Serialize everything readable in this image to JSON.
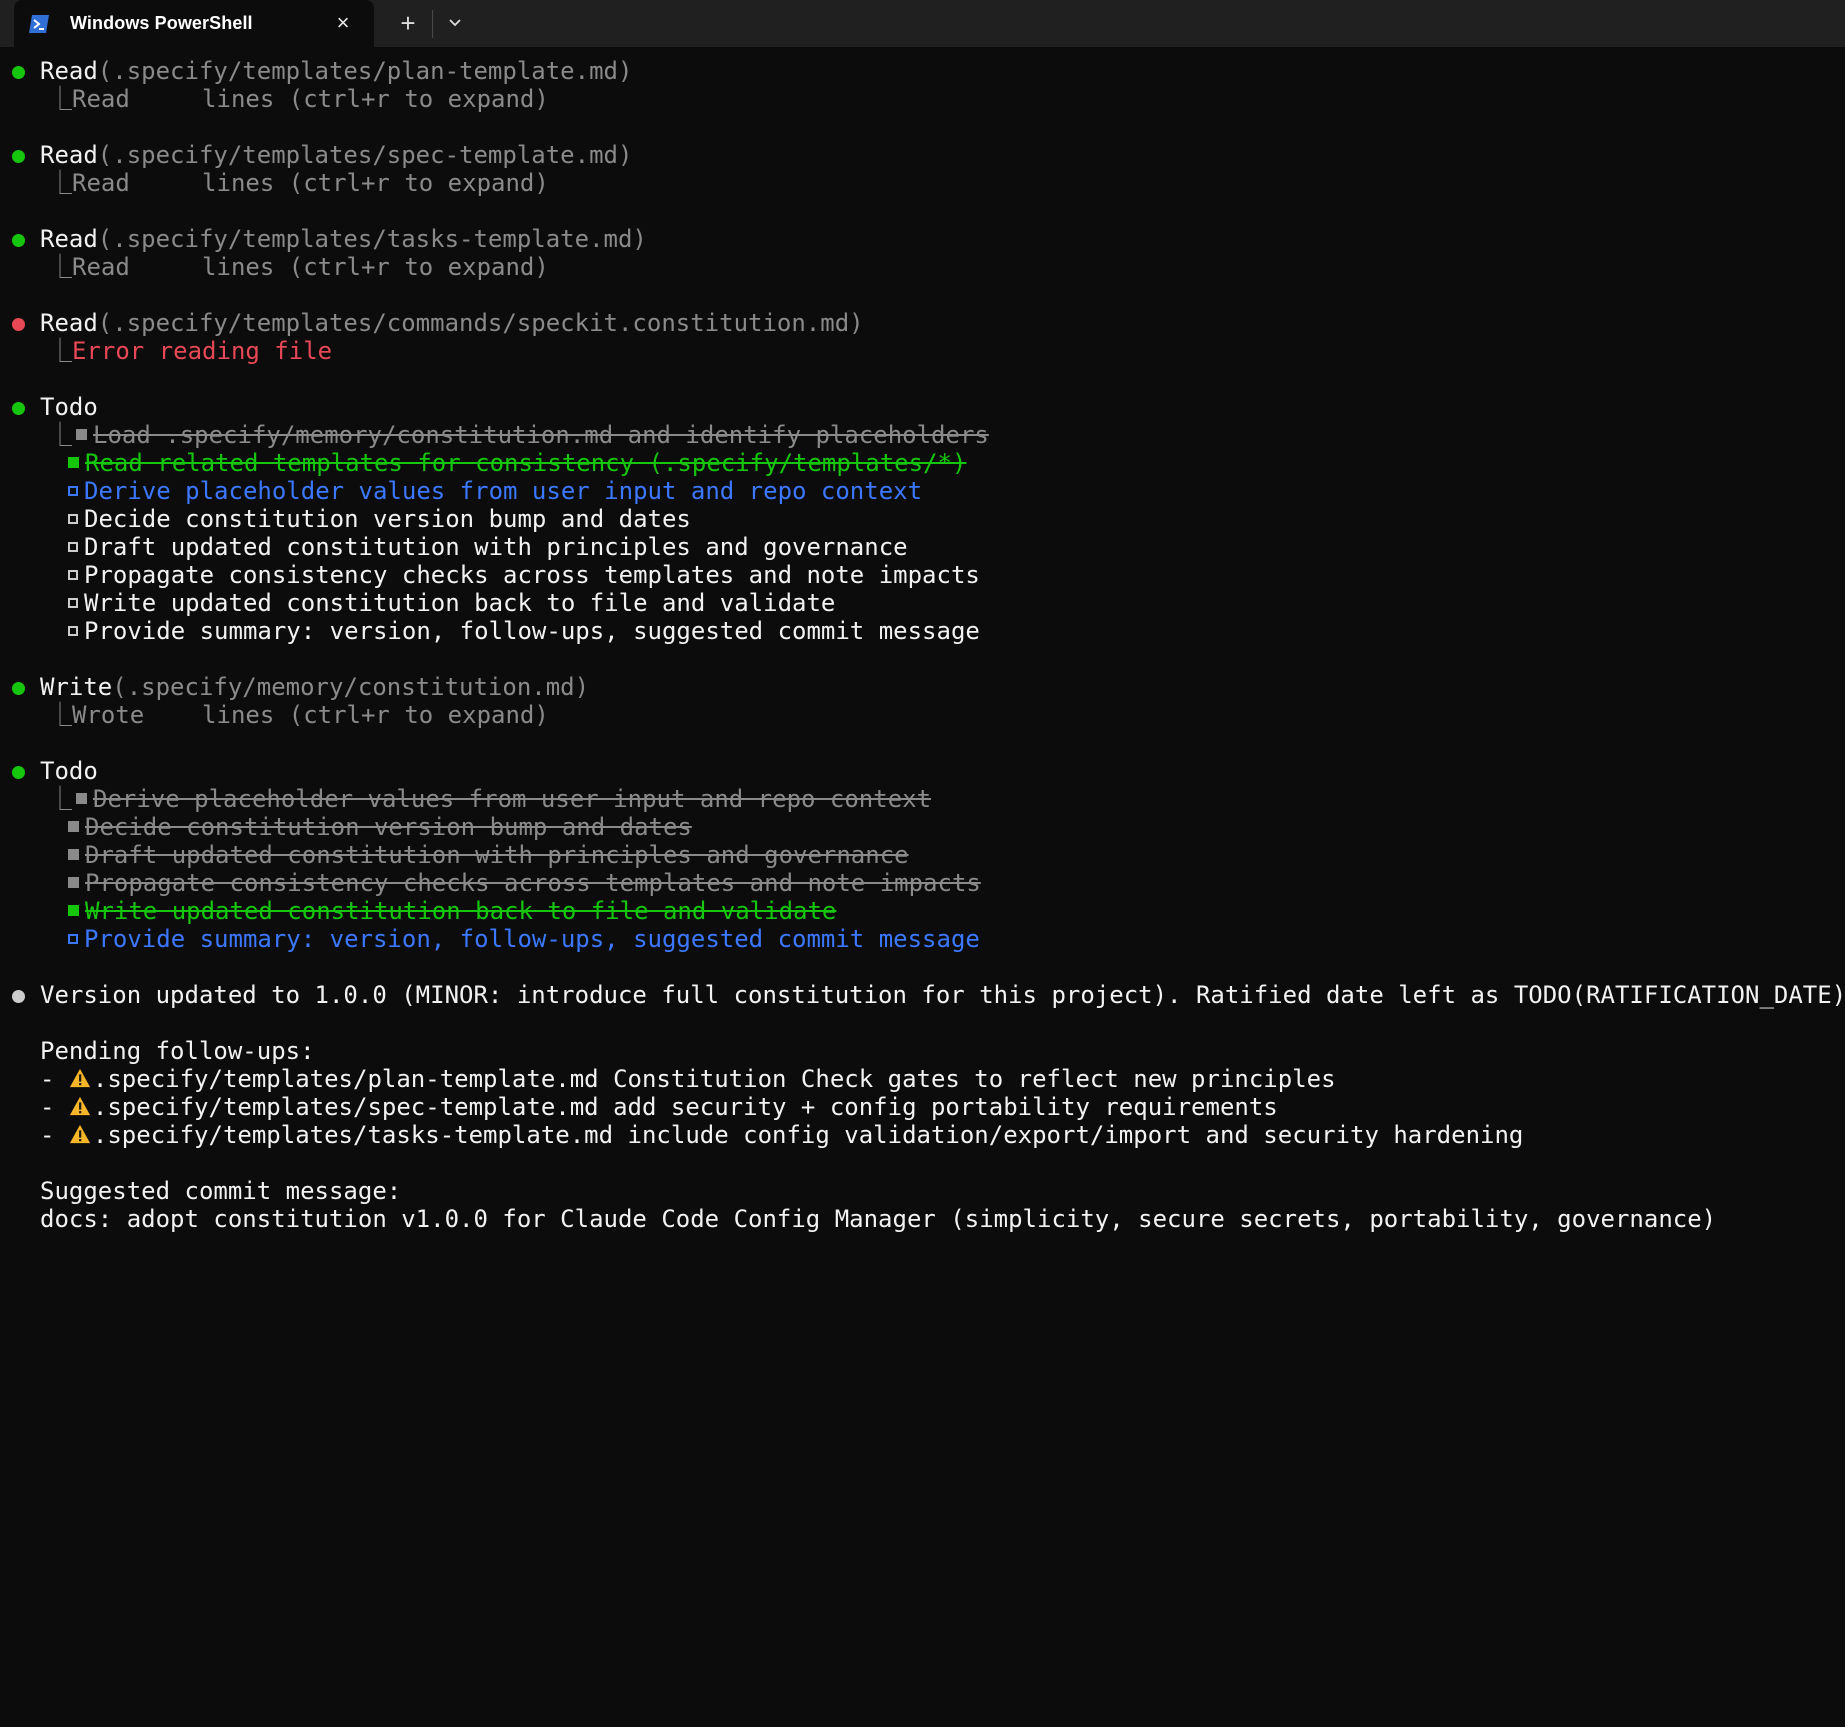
{
  "window": {
    "tab_title": "Windows PowerShell",
    "tab_icon": "powershell-icon",
    "new_tab_label": "+",
    "close_label": "×"
  },
  "colors": {
    "success": "#16c60c",
    "error": "#e74856",
    "in_progress": "#3b78ff",
    "muted": "#8a8a8a",
    "warning": "#f6b627"
  },
  "blocks": {
    "read1": {
      "tool": "Read",
      "arg": "(.specify/templates/plan-template.md)",
      "result": "Read     lines (ctrl+r to expand)"
    },
    "read2": {
      "tool": "Read",
      "arg": "(.specify/templates/spec-template.md)",
      "result": "Read     lines (ctrl+r to expand)"
    },
    "read3": {
      "tool": "Read",
      "arg": "(.specify/templates/tasks-template.md)",
      "result": "Read     lines (ctrl+r to expand)"
    },
    "read4": {
      "tool": "Read",
      "arg": "(.specify/templates/commands/speckit.constitution.md)",
      "result": "Error reading file"
    },
    "todo1": {
      "title": "Todo",
      "items": [
        "Load .specify/memory/constitution.md and identify placeholders",
        "Read related templates for consistency (.specify/templates/*)",
        "Derive placeholder values from user input and repo context",
        "Decide constitution version bump and dates",
        "Draft updated constitution with principles and governance",
        "Propagate consistency checks across templates and note impacts",
        "Write updated constitution back to file and validate",
        "Provide summary: version, follow-ups, suggested commit message"
      ]
    },
    "write1": {
      "tool": "Write",
      "arg": "(.specify/memory/constitution.md)",
      "result": "Wrote    lines (ctrl+r to expand)"
    },
    "todo2": {
      "title": "Todo",
      "items": [
        "Derive placeholder values from user input and repo context",
        "Decide constitution version bump and dates",
        "Draft updated constitution with principles and governance",
        "Propagate consistency checks across templates and note impacts",
        "Write updated constitution back to file and validate",
        "Provide summary: version, follow-ups, suggested commit message"
      ]
    }
  },
  "summary": {
    "version_line": "Version updated to 1.0.0 (MINOR: introduce full constitution for this project). Ratified date left as TODO(RATIFICATION_DATE).",
    "followups_heading": "Pending follow-ups:",
    "followups": [
      ".specify/templates/plan-template.md Constitution Check gates to reflect new principles",
      ".specify/templates/spec-template.md add security + config portability requirements",
      ".specify/templates/tasks-template.md include config validation/export/import and security hardening"
    ],
    "commit_heading": "Suggested commit message:",
    "commit_message": "docs: adopt constitution v1.0.0 for Claude Code Config Manager (simplicity, secure secrets, portability, governance)"
  },
  "glyphs": {
    "elbow": "⎿",
    "dash": "-"
  }
}
